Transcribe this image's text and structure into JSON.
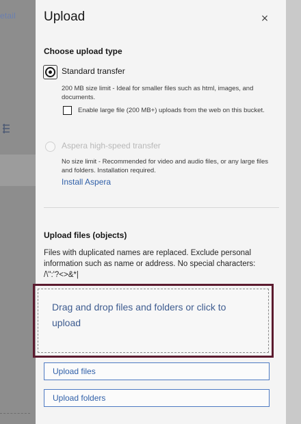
{
  "backdrop": {
    "tab_fragment": "etail",
    "icon": "stack-icon"
  },
  "dialog": {
    "title": "Upload",
    "close_label": "×"
  },
  "upload_type": {
    "heading": "Choose upload type",
    "standard": {
      "label": "Standard transfer",
      "selected": true,
      "description": "200 MB size limit - Ideal for smaller files such as html, images, and documents.",
      "large_file_checkbox": {
        "label": "Enable large file (200 MB+) uploads from the web on this bucket.",
        "checked": false
      }
    },
    "aspera": {
      "label": "Aspera high-speed transfer",
      "selected": false,
      "enabled": false,
      "description": "No size limit - Recommended for video and audio files, or any large files and folders. Installation required.",
      "install_link": "Install Aspera"
    }
  },
  "upload_files": {
    "heading": "Upload files (objects)",
    "description": "Files with duplicated names are replaced. Exclude personal information such as name or address. No special characters: /\\\":'?<>&*|",
    "drop_zone_text": "Drag and drop files and folders or click to upload",
    "upload_files_button": "Upload files",
    "upload_folders_button": "Upload folders"
  },
  "colors": {
    "accent_link": "#2f5fa8",
    "highlight_border": "#5b1a2e",
    "panel_bg": "#f4f4f4"
  }
}
